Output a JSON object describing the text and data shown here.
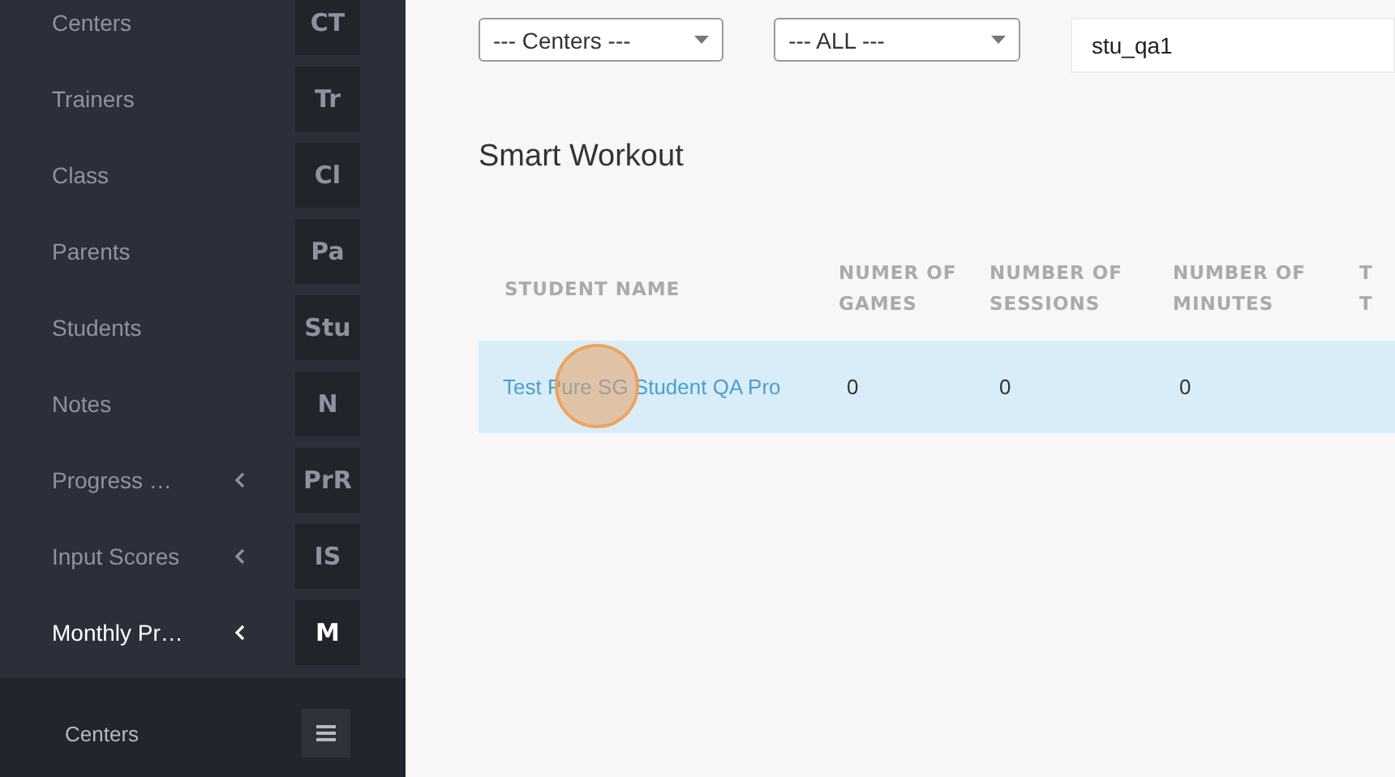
{
  "sidebar": {
    "items": [
      {
        "label": "Centers",
        "abbr": "CT",
        "has_submenu": false,
        "selected": false
      },
      {
        "label": "Trainers",
        "abbr": "Tr",
        "has_submenu": false,
        "selected": false
      },
      {
        "label": "Class",
        "abbr": "Cl",
        "has_submenu": false,
        "selected": false
      },
      {
        "label": "Parents",
        "abbr": "Pa",
        "has_submenu": false,
        "selected": false
      },
      {
        "label": "Students",
        "abbr": "Stu",
        "has_submenu": false,
        "selected": false
      },
      {
        "label": "Notes",
        "abbr": "N",
        "has_submenu": false,
        "selected": false
      },
      {
        "label": "Progress …",
        "abbr": "PrR",
        "has_submenu": true,
        "selected": false
      },
      {
        "label": "Input Scores",
        "abbr": "IS",
        "has_submenu": true,
        "selected": false
      },
      {
        "label": "Monthly Pr…",
        "abbr": "M",
        "has_submenu": true,
        "selected": true,
        "children": [
          {
            "label": "Centers"
          }
        ]
      }
    ]
  },
  "filters": {
    "center_select": "--- Centers ---",
    "group_select": "--- ALL ---",
    "search": {
      "value": "stu_qa1"
    }
  },
  "section_title": "Smart Workout",
  "table": {
    "columns": [
      {
        "lines": [
          "STUDENT NAME"
        ]
      },
      {
        "lines": [
          "NUMER OF",
          "GAMES"
        ]
      },
      {
        "lines": [
          "NUMBER OF",
          "SESSIONS"
        ]
      },
      {
        "lines": [
          "NUMBER OF",
          "MINUTES"
        ]
      },
      {
        "lines": [
          "T",
          "T"
        ]
      }
    ],
    "rows": [
      {
        "selected": true,
        "cells": [
          "Test Pure SG Student QA Pro",
          "0",
          "0",
          "0"
        ]
      }
    ]
  },
  "click_marker": {
    "shown": true
  }
}
